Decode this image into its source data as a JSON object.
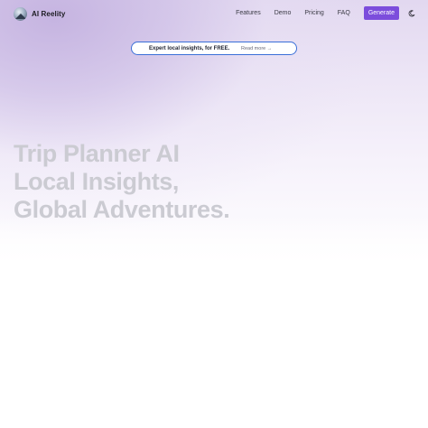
{
  "brand": {
    "name": "AI Reelity",
    "logo_icon": "globe-logo-icon"
  },
  "nav": {
    "links": [
      "Features",
      "Demo",
      "Pricing",
      "FAQ"
    ],
    "cta_label": "Generate",
    "theme_toggle_icon": "moon-icon"
  },
  "announcement": {
    "text": "Expert local insights, for FREE.",
    "link_text": "Read more →"
  },
  "hero": {
    "headline_lines": [
      "Trip Planner AI",
      "Local Insights,",
      "Global Adventures."
    ]
  },
  "colors": {
    "accent": "#7c4ddc",
    "announcement_border": "#3a6fd8",
    "headline_text": "#cbcbd2",
    "hero_gradient": "#d9cdec"
  }
}
